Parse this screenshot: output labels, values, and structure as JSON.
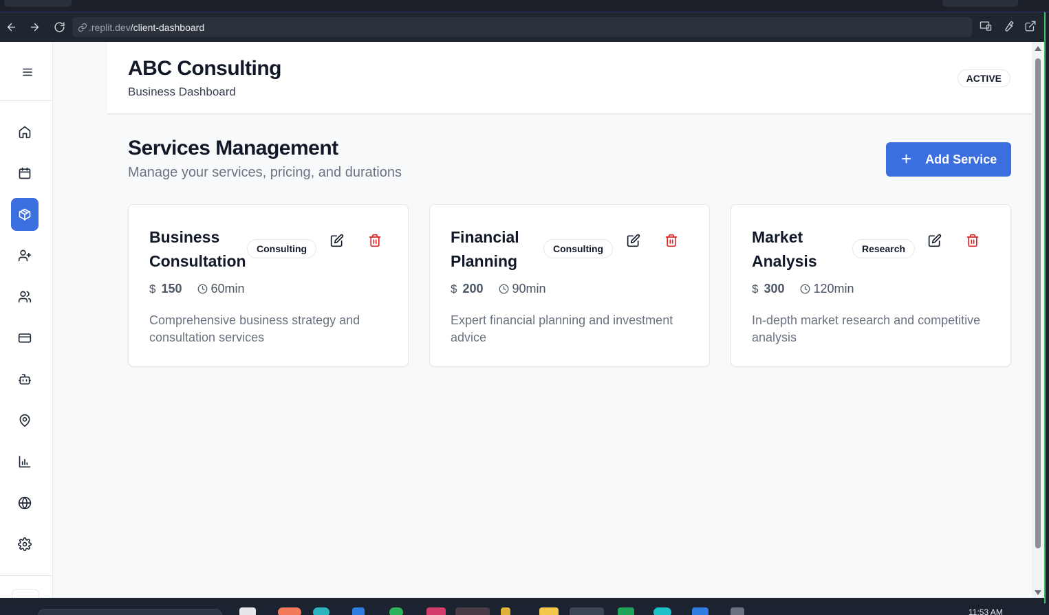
{
  "browser": {
    "url_host": ".replit.dev",
    "url_path": "/client-dashboard"
  },
  "header": {
    "brand": "ABC Consulting",
    "subtitle": "Business Dashboard",
    "status": "ACTIVE"
  },
  "sidebar": {
    "items": [
      {
        "name": "home",
        "icon": "home-icon"
      },
      {
        "name": "calendar",
        "icon": "calendar-icon"
      },
      {
        "name": "services",
        "icon": "package-icon",
        "active": true
      },
      {
        "name": "add-client",
        "icon": "user-plus-icon"
      },
      {
        "name": "clients",
        "icon": "users-icon"
      },
      {
        "name": "payments",
        "icon": "credit-card-icon"
      },
      {
        "name": "bot",
        "icon": "bot-icon"
      },
      {
        "name": "locations",
        "icon": "map-pin-icon"
      },
      {
        "name": "analytics",
        "icon": "bar-chart-icon"
      },
      {
        "name": "website",
        "icon": "globe-icon"
      },
      {
        "name": "settings",
        "icon": "gear-icon"
      }
    ]
  },
  "main": {
    "title": "Services Management",
    "subtitle": "Manage your services, pricing, and durations",
    "add_button": "Add Service",
    "services": [
      {
        "title": "Business Consultation",
        "category": "Consulting",
        "price": "150",
        "duration": "60min",
        "description": "Comprehensive business strategy and consultation services"
      },
      {
        "title": "Financial Planning",
        "category": "Consulting",
        "price": "200",
        "duration": "90min",
        "description": "Expert financial planning and investment advice"
      },
      {
        "title": "Market Analysis",
        "category": "Research",
        "price": "300",
        "duration": "120min",
        "description": "In-depth market research and competitive analysis"
      }
    ]
  },
  "taskbar": {
    "time": "11:53 AM"
  },
  "colors": {
    "accent": "#3b6fe0",
    "danger": "#dc2626"
  }
}
